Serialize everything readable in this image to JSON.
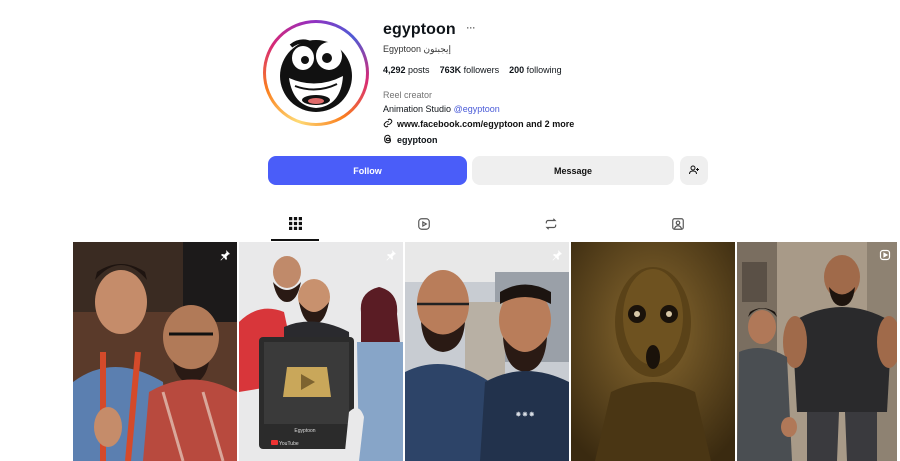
{
  "profile": {
    "username": "egyptoon",
    "more_label": "···",
    "full_name": "Egyptoon إيجبتون",
    "stats": {
      "posts_count": "4,292",
      "posts_label": "posts",
      "followers_count": "763K",
      "followers_label": "followers",
      "following_count": "200",
      "following_label": "following"
    },
    "category": "Reel creator",
    "bio_text": "Animation Studio",
    "bio_mention": "@egyptoon",
    "link": "www.facebook.com/egyptoon and 2 more",
    "threads": "egyptoon"
  },
  "actions": {
    "follow_label": "Follow",
    "message_label": "Message"
  },
  "tabs": [
    {
      "icon": "grid-icon",
      "active": true
    },
    {
      "icon": "reels-icon",
      "active": false
    },
    {
      "icon": "reposts-icon",
      "active": false
    },
    {
      "icon": "tagged-icon",
      "active": false
    }
  ],
  "grid": [
    {
      "name": "post-1",
      "pinned": true,
      "type": "image"
    },
    {
      "name": "post-2",
      "pinned": true,
      "type": "image",
      "caption_lines": [
        "Egyptoon",
        "YouTube"
      ]
    },
    {
      "name": "post-3",
      "pinned": true,
      "type": "image"
    },
    {
      "name": "post-4",
      "pinned": false,
      "type": "image"
    },
    {
      "name": "post-5",
      "pinned": false,
      "type": "reel"
    }
  ],
  "colors": {
    "accent": "#4a5df9",
    "mention": "#4a5bd8",
    "muted": "#737373",
    "button_gray": "#efefef"
  }
}
